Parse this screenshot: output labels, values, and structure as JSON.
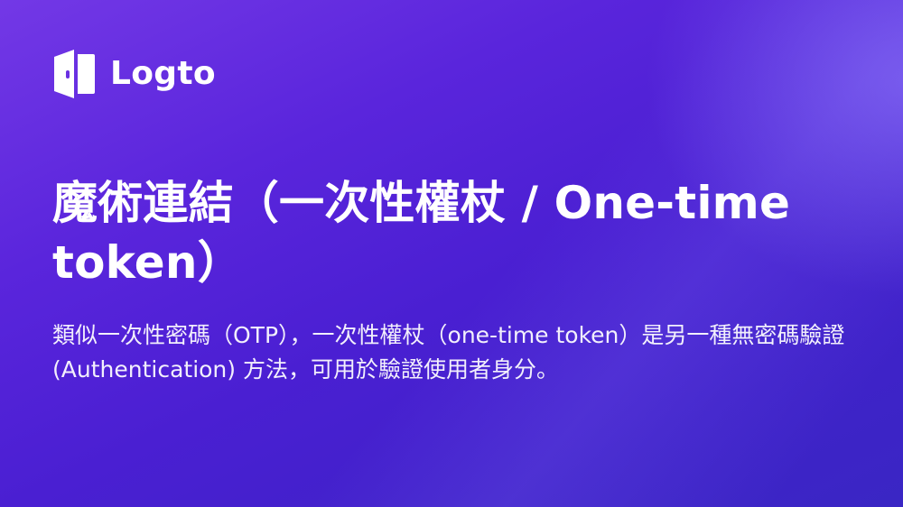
{
  "brand": {
    "name": "Logto",
    "icon": "logto-door-icon",
    "text_color": "#ffffff"
  },
  "title": "魔術連結（一次性權杖 / One-time token）",
  "subtitle": "類似一次性密碼（OTP），一次性權杖（one-time token）是另一種無密碼驗證 (Authentication) 方法，可用於驗證使用者身分。",
  "colors": {
    "background_start": "#7338e6",
    "background_end": "#3a26c4",
    "text": "#ffffff"
  }
}
